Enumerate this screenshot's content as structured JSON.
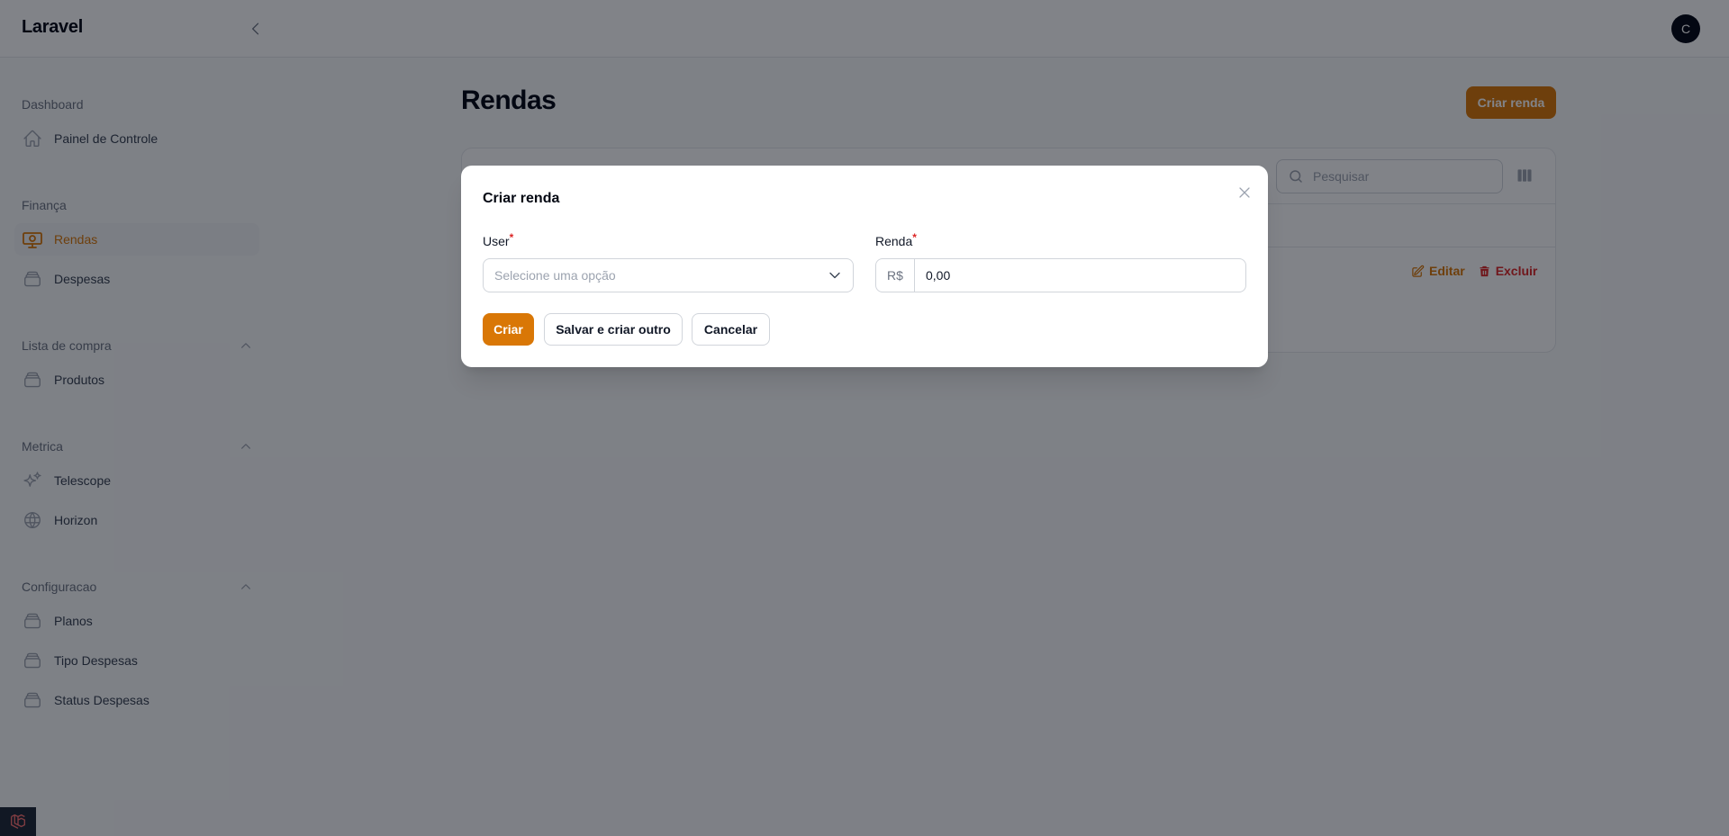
{
  "app": {
    "title": "Laravel",
    "user_initial": "C"
  },
  "sidebar": {
    "groups": [
      {
        "label": "Dashboard",
        "items": [
          {
            "label": "Painel de Controle",
            "icon": "home-icon"
          }
        ]
      },
      {
        "label": "Finança",
        "items": [
          {
            "label": "Rendas",
            "icon": "banknotes-icon",
            "active": true
          },
          {
            "label": "Despesas",
            "icon": "stack-icon"
          }
        ]
      },
      {
        "label": "Lista de compra",
        "collapsible": true,
        "items": [
          {
            "label": "Produtos",
            "icon": "stack-icon"
          }
        ]
      },
      {
        "label": "Metrica",
        "collapsible": true,
        "items": [
          {
            "label": "Telescope",
            "icon": "sparkles-icon"
          },
          {
            "label": "Horizon",
            "icon": "globe-icon"
          }
        ]
      },
      {
        "label": "Configuracao",
        "collapsible": true,
        "items": [
          {
            "label": "Planos",
            "icon": "stack-icon"
          },
          {
            "label": "Tipo Despesas",
            "icon": "stack-icon"
          },
          {
            "label": "Status Despesas",
            "icon": "stack-icon"
          }
        ]
      }
    ]
  },
  "page": {
    "title": "Rendas",
    "create_label": "Criar renda",
    "search_placeholder": "Pesquisar",
    "row_actions": {
      "edit": "Editar",
      "delete": "Excluir"
    }
  },
  "modal": {
    "title": "Criar renda",
    "user_label": "User",
    "user_placeholder": "Selecione uma opção",
    "renda_label": "Renda",
    "currency_prefix": "R$",
    "renda_value": "0,00",
    "required_mark": "*",
    "buttons": {
      "create": "Criar",
      "save_and_create_another": "Salvar e criar outro",
      "cancel": "Cancelar"
    }
  },
  "colors": {
    "accent": "#d97706",
    "danger": "#dc2626",
    "overlay": "rgba(3,7,18,0.5)"
  }
}
